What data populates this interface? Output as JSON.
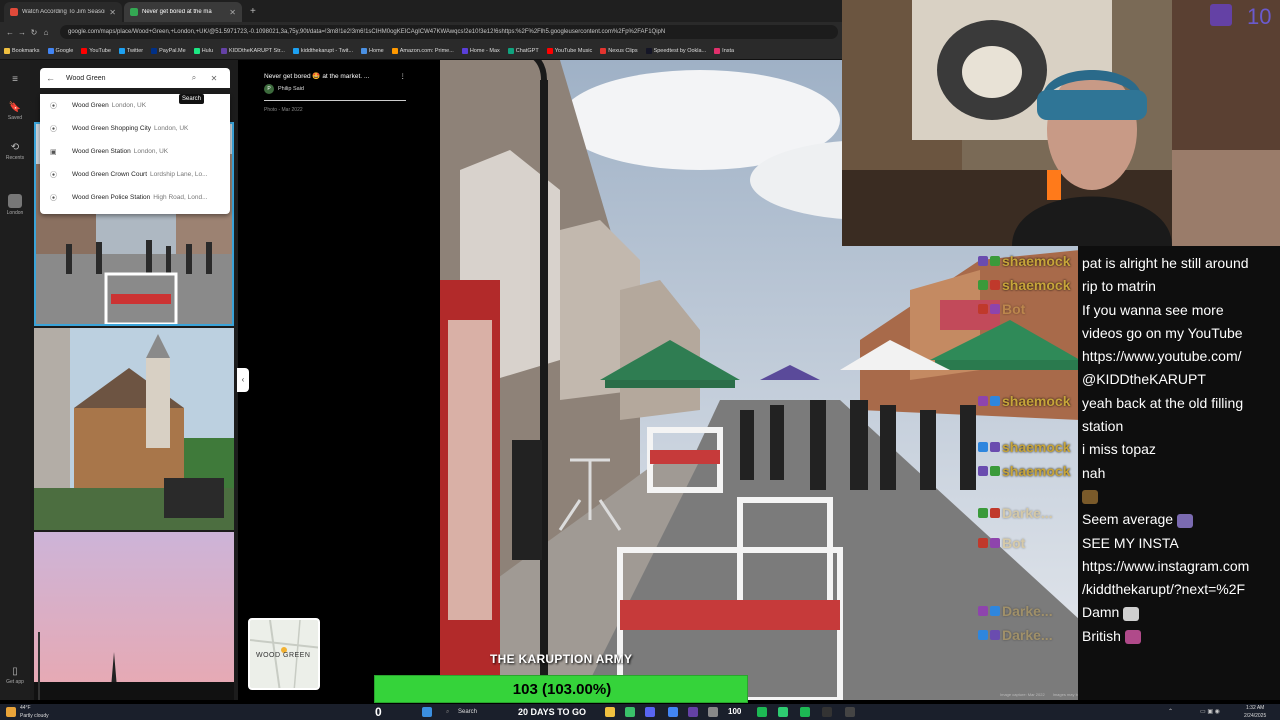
{
  "browser": {
    "tabs": [
      {
        "label": "Watch According To Jim Season",
        "state": "inactive"
      },
      {
        "label": "Never get bored at the ma",
        "state": "active"
      }
    ],
    "new_tab": "+",
    "url": "google.com/maps/place/Wood+Green,+London,+UK/@51.5971723,-0.1098021,3a,75y,90t/data=!3m8!1e2!3m6!1sCIHM0ogKEICAgICW47KWAwqcs!2e10!3e12!6shttps:%2F%2Flh5.googleusercontent.com%2Fp%2FAF1QipN",
    "bookmarks": [
      "Bookmarks",
      "Google",
      "YouTube",
      "Twitter",
      "PayPal.Me",
      "Hulu",
      "KIDDtheKARUPT Str...",
      "kiddthekarupt - Twit...",
      "Home",
      "Amazon.com: Prime...",
      "Home - Max",
      "ChatGPT",
      "YouTube Music",
      "Nexus Clips",
      "Speedtest by Ookla...",
      "Insta"
    ]
  },
  "maps": {
    "rail": {
      "saved": "Saved",
      "recents": "Recents",
      "london": "London",
      "get_app": "Get app"
    },
    "search": {
      "value": "Wood Green",
      "tooltip": "Search"
    },
    "suggestions": [
      {
        "name": "Wood Green",
        "sub": "London, UK"
      },
      {
        "name": "Wood Green Shopping City",
        "sub": "London, UK"
      },
      {
        "name": "Wood Green Station",
        "sub": "London, UK"
      },
      {
        "name": "Wood Green Crown Court",
        "sub": "Lordship Lane, Lo..."
      },
      {
        "name": "Wood Green Police Station",
        "sub": "High Road, Lond..."
      }
    ],
    "photo_card": {
      "title": "Never get bored 🤩 at the market. ...",
      "author_initial": "P",
      "author": "Philip Said",
      "date": "Photo - Mar 2022"
    },
    "minimap_label": "WOOD GREEN",
    "footer": [
      "Image capture: Mar 2022",
      "Images may be subject to copyright.",
      "United States",
      "Terms",
      "Privacy",
      "Report a problem"
    ]
  },
  "stream": {
    "goal_title": "THE KARUPTION ARMY",
    "goal_text": "103 (103.00%)",
    "goal_progress": 1.0,
    "overlay_names": [
      {
        "name": "shaemock",
        "faded": false
      },
      {
        "name": "shaemock",
        "faded": false
      },
      {
        "name": "Bot",
        "faded": true
      },
      {
        "name": "shaemock",
        "faded": false
      },
      {
        "name": "shaemock",
        "faded": false
      },
      {
        "name": "shaemock",
        "faded": false
      },
      {
        "name": "Darke...",
        "faded": true
      },
      {
        "name": "Bot",
        "faded": true
      },
      {
        "name": "Darke...",
        "faded": true
      },
      {
        "name": "Darke...",
        "faded": true
      }
    ],
    "chat": [
      "pat is alright he still around",
      "rip to matrin",
      "If you wanna see more",
      "videos go on my YouTube",
      "https://www.youtube.com/",
      "@KIDDtheKARUPT",
      "yeah back at the old filling",
      "station",
      "i miss topaz",
      "nah",
      "",
      "Seem average",
      "SEE MY INSTA",
      "https://www.instagram.com",
      "/kiddthekarupt/?next=%2F",
      "Damn",
      "British"
    ],
    "webcam_number": "10"
  },
  "taskbar": {
    "weather_temp": "44°F",
    "weather_desc": "Partly cloudy",
    "search": "Search",
    "countdown": "20 DAYS TO GO",
    "badge": "100",
    "time": "1:32 AM",
    "date": "2/24/2025",
    "left_counter": "0"
  },
  "colors": {
    "goal_green": "#35d33a",
    "username_gold": "#c7a53a",
    "chat_bg": "#0e0e0e"
  }
}
